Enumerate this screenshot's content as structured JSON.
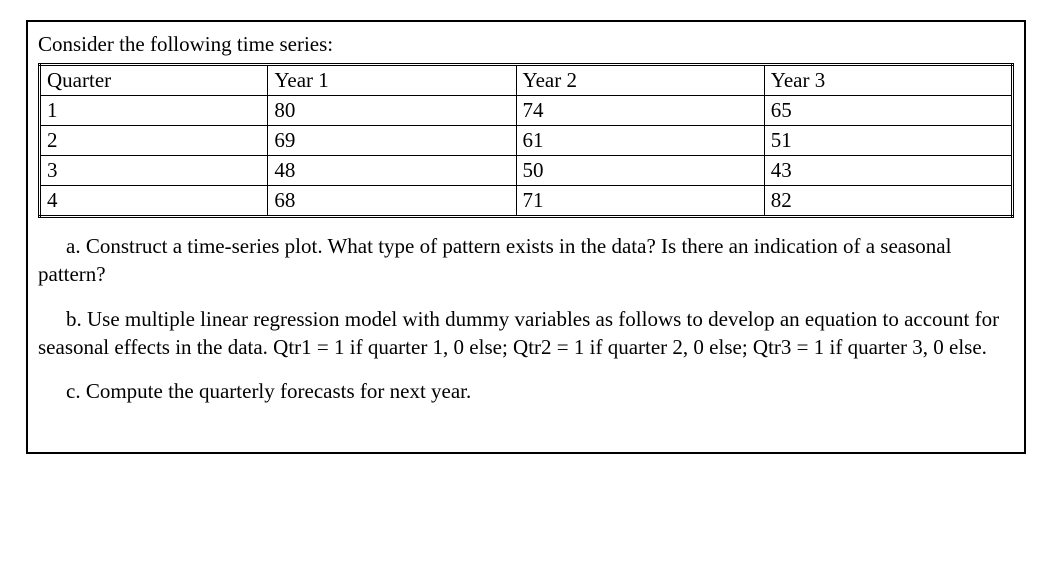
{
  "intro": "Consider the following time series:",
  "chart_data": {
    "type": "table",
    "title": "",
    "columns": [
      "Quarter",
      "Year 1",
      "Year 2",
      "Year 3"
    ],
    "rows": [
      {
        "quarter": "1",
        "year1": "80",
        "year2": "74",
        "year3": "65"
      },
      {
        "quarter": "2",
        "year1": "69",
        "year2": "61",
        "year3": "51"
      },
      {
        "quarter": "3",
        "year1": "48",
        "year2": "50",
        "year3": "43"
      },
      {
        "quarter": "4",
        "year1": "68",
        "year2": "71",
        "year3": "82"
      }
    ]
  },
  "questions": {
    "a": "a. Construct a time-series plot. What type of pattern exists in the data? Is there an indication of a seasonal pattern?",
    "b": "b. Use multiple linear regression model with dummy variables as follows to develop an equation to account for seasonal effects in the data. Qtr1 = 1 if quarter 1, 0 else; Qtr2 = 1 if quarter 2, 0 else; Qtr3 = 1 if quarter 3, 0 else.",
    "c": "c. Compute the quarterly forecasts for next year."
  }
}
